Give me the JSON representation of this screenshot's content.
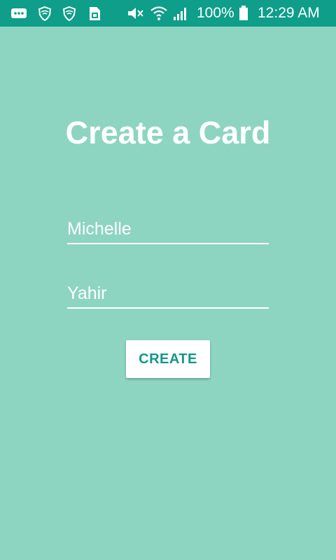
{
  "status_bar": {
    "icons": [
      "message-icon",
      "shield-icon",
      "shield-icon",
      "sim-icon",
      "mute-icon",
      "wifi-icon",
      "signal-icon"
    ],
    "battery_percent": "100%",
    "time": "12:29 AM",
    "background_color": "#0e9e8a"
  },
  "screen": {
    "title": "Create a Card",
    "background_color": "#8dd5c0"
  },
  "form": {
    "first_field_value": "Michelle",
    "second_field_value": "Yahir",
    "create_label": "CREATE",
    "accent_color": "#12978a"
  }
}
